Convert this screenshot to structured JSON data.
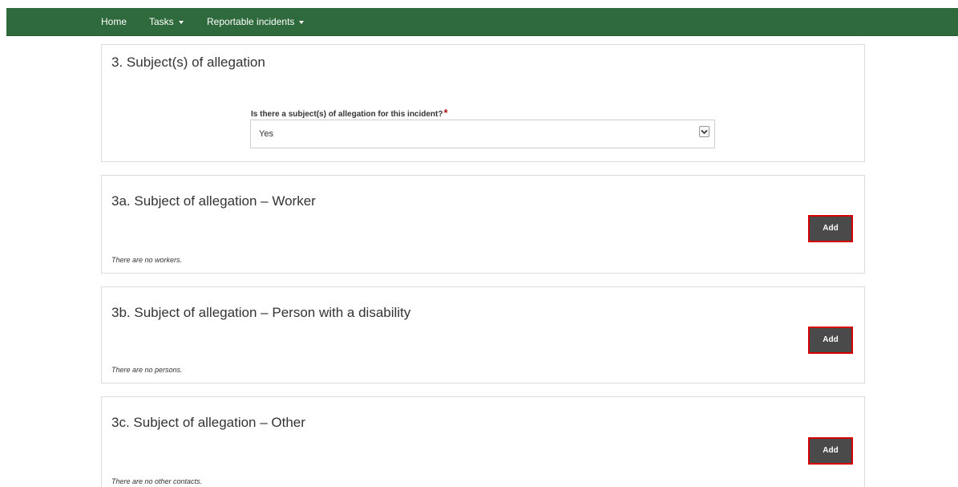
{
  "nav": {
    "home": "Home",
    "tasks": "Tasks",
    "reportable": "Reportable incidents"
  },
  "section3": {
    "title": "3. Subject(s) of allegation",
    "question": "Is there a subject(s) of allegation for this incident?",
    "required_marker": "*",
    "selected_value": "Yes"
  },
  "section3a": {
    "title": "3a. Subject of allegation – Worker",
    "add_label": "Add",
    "empty_text": "There are no workers."
  },
  "section3b": {
    "title": "3b. Subject of allegation – Person with a disability",
    "add_label": "Add",
    "empty_text": "There are no persons."
  },
  "section3c": {
    "title": "3c. Subject of allegation – Other",
    "add_label": "Add",
    "empty_text": "There are no other contacts."
  },
  "colors": {
    "navbar": "#2e6a3b",
    "button": "#4a4a4a",
    "button_border": "#d40000",
    "required": "#b31414"
  }
}
